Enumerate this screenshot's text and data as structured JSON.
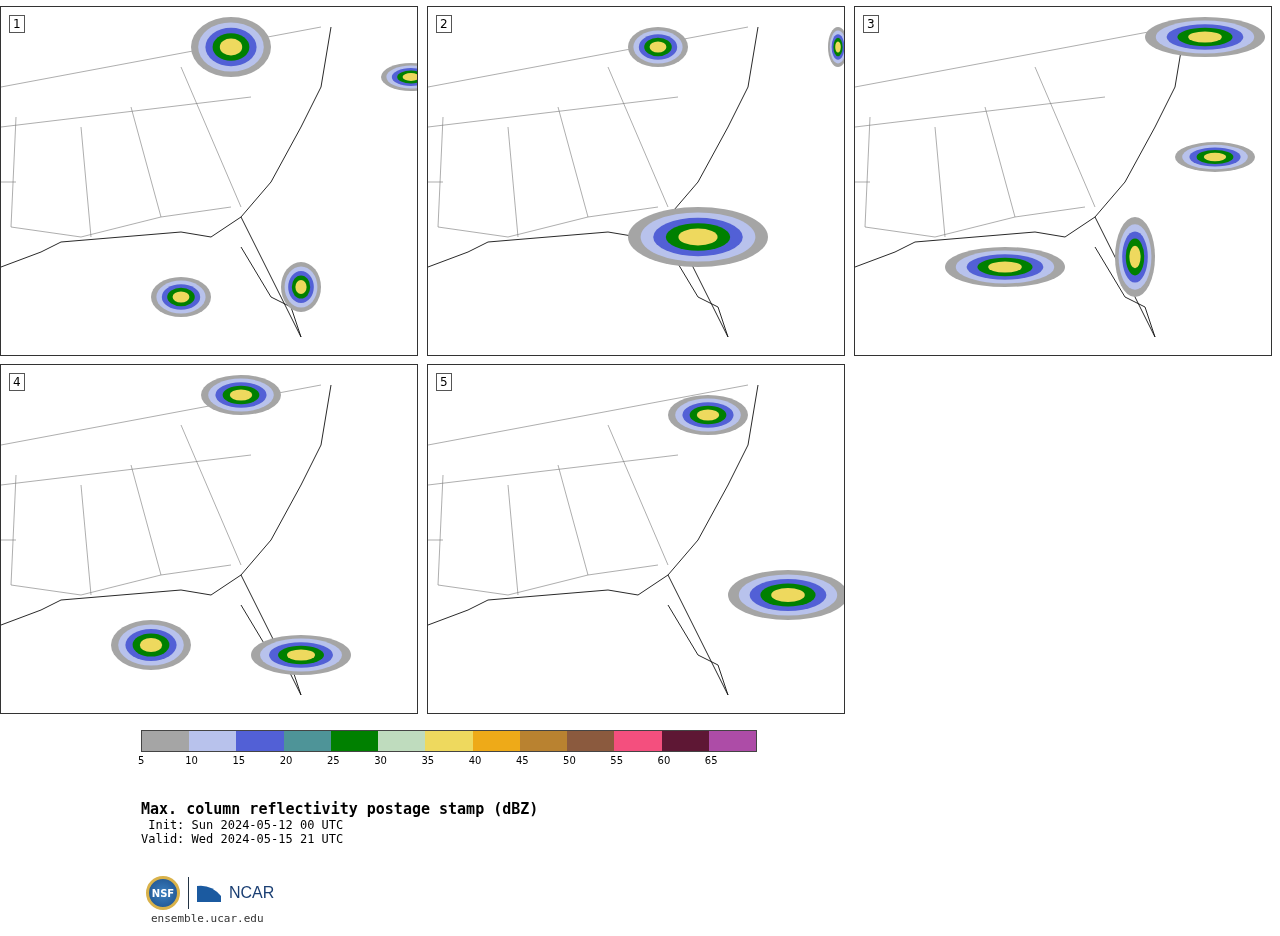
{
  "panels": [
    {
      "label": "1"
    },
    {
      "label": "2"
    },
    {
      "label": "3"
    },
    {
      "label": "4"
    },
    {
      "label": "5"
    }
  ],
  "colorbar": {
    "bins": [
      {
        "color": "#a5a5a5"
      },
      {
        "color": "#b8c2ec"
      },
      {
        "color": "#5260d6"
      },
      {
        "color": "#4e9498"
      },
      {
        "color": "#008000"
      },
      {
        "color": "#bfdcbe"
      },
      {
        "color": "#eed95e"
      },
      {
        "color": "#eeaa18"
      },
      {
        "color": "#b98230"
      },
      {
        "color": "#8b5a3e"
      },
      {
        "color": "#f44f7e"
      },
      {
        "color": "#5e1734"
      },
      {
        "color": "#ad4ca7"
      }
    ],
    "ticks": [
      "5",
      "10",
      "15",
      "20",
      "25",
      "30",
      "35",
      "40",
      "45",
      "50",
      "55",
      "60",
      "65"
    ]
  },
  "title": "Max. column reflectivity postage stamp (dBZ)",
  "init": " Init: Sun 2024-05-12 00 UTC",
  "valid": "Valid: Wed 2024-05-15 21 UTC",
  "logos": {
    "nsf": "NSF",
    "ncar": "NCAR"
  },
  "url": "ensemble.ucar.edu"
}
